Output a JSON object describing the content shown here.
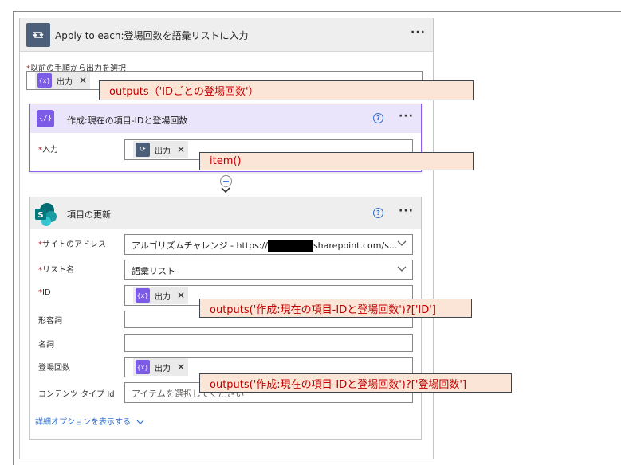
{
  "apply_each": {
    "title": "Apply to each:登場回数を語彙リストに入力",
    "more": "···",
    "select_label": "以前の手順から出力を選択",
    "required_mark": "*",
    "token_label": "出力",
    "token_close": "✕"
  },
  "compose": {
    "title": "作成:現在の項目-IDと登場回数",
    "help": "?",
    "more": "···",
    "input_label": "入力",
    "token_label": "出力",
    "token_close": "✕"
  },
  "connector": {
    "add": "+",
    "arrow": "⌄"
  },
  "update_item": {
    "title": "項目の更新",
    "help": "?",
    "more": "···",
    "fields": {
      "site_label": "サイトのアドレス",
      "site_value_prefix": "アルゴリズムチャレンジ - https://",
      "site_value_suffix": "sharepoint.com/s...",
      "list_label": "リスト名",
      "list_value": "語彙リスト",
      "id_label": "ID",
      "adjective_label": "形容詞",
      "noun_label": "名詞",
      "count_label": "登場回数",
      "content_type_label": "コンテンツ タイプ Id",
      "content_type_placeholder": "アイテムを選択してください"
    },
    "token_label": "出力",
    "token_close": "✕",
    "advanced_options": "詳細オプションを表示する"
  },
  "callouts": {
    "outputs_id": "outputs（'IDごとの登場回数'）",
    "item": "item()",
    "id_expr": "outputs('作成:現在の項目-IDと登場回数')?['ID']",
    "count_expr": "outputs('作成:現在の項目-IDと登場回数')?['登場回数']"
  },
  "colors": {
    "loop_icon": "#4b5f7a",
    "compose_icon": "#7c5ce6",
    "callout_bg": "#fbe5d6",
    "callout_text": "#c00000",
    "link": "#2b6cd0",
    "required": "#a4262c"
  },
  "icons": {
    "loop": "loop-icon",
    "compose": "compose-icon",
    "sharepoint": "sharepoint-icon",
    "help": "help-icon",
    "chevron": "chevron-down-icon",
    "close": "close-icon",
    "add": "add-step-icon"
  }
}
